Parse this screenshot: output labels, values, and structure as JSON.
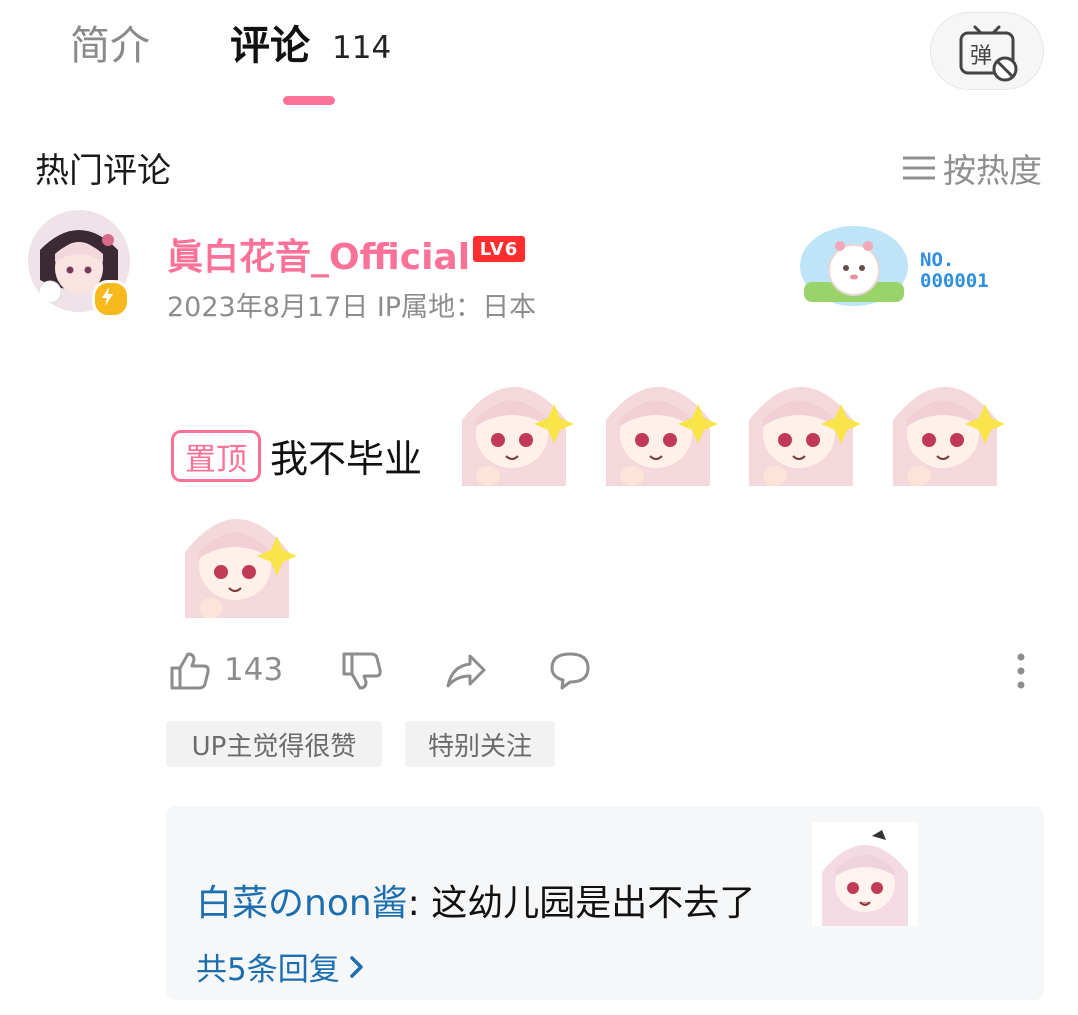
{
  "tabs": [
    {
      "label": "简介",
      "active": false
    },
    {
      "label": "评论",
      "active": true,
      "count": "114"
    }
  ],
  "danmaku_button": {
    "label": "弹",
    "icon": "danmaku-off-icon"
  },
  "section": {
    "title": "热门评论",
    "sort_label": "按热度",
    "sort_icon": "menu-lines-icon"
  },
  "comment": {
    "username": "眞白花音_Official",
    "level": "LV6",
    "date": "2023年8月17日",
    "ip_label": "IP属地：日本",
    "fan_badge_number": "NO.\n000001",
    "pin_label": "置顶",
    "text": "我不毕业",
    "emote_count": 5,
    "likes": "143",
    "tags": [
      "UP主觉得很赞",
      "特别关注"
    ]
  },
  "reply_preview": {
    "username": "白菜のnon酱",
    "text": ": 这幼儿园是出不去了",
    "more_label": "共5条回复"
  },
  "colors": {
    "brand_pink": "#fb7299",
    "reply_link_blue": "#1c6eaf",
    "level_red": "#ff2e2e"
  }
}
